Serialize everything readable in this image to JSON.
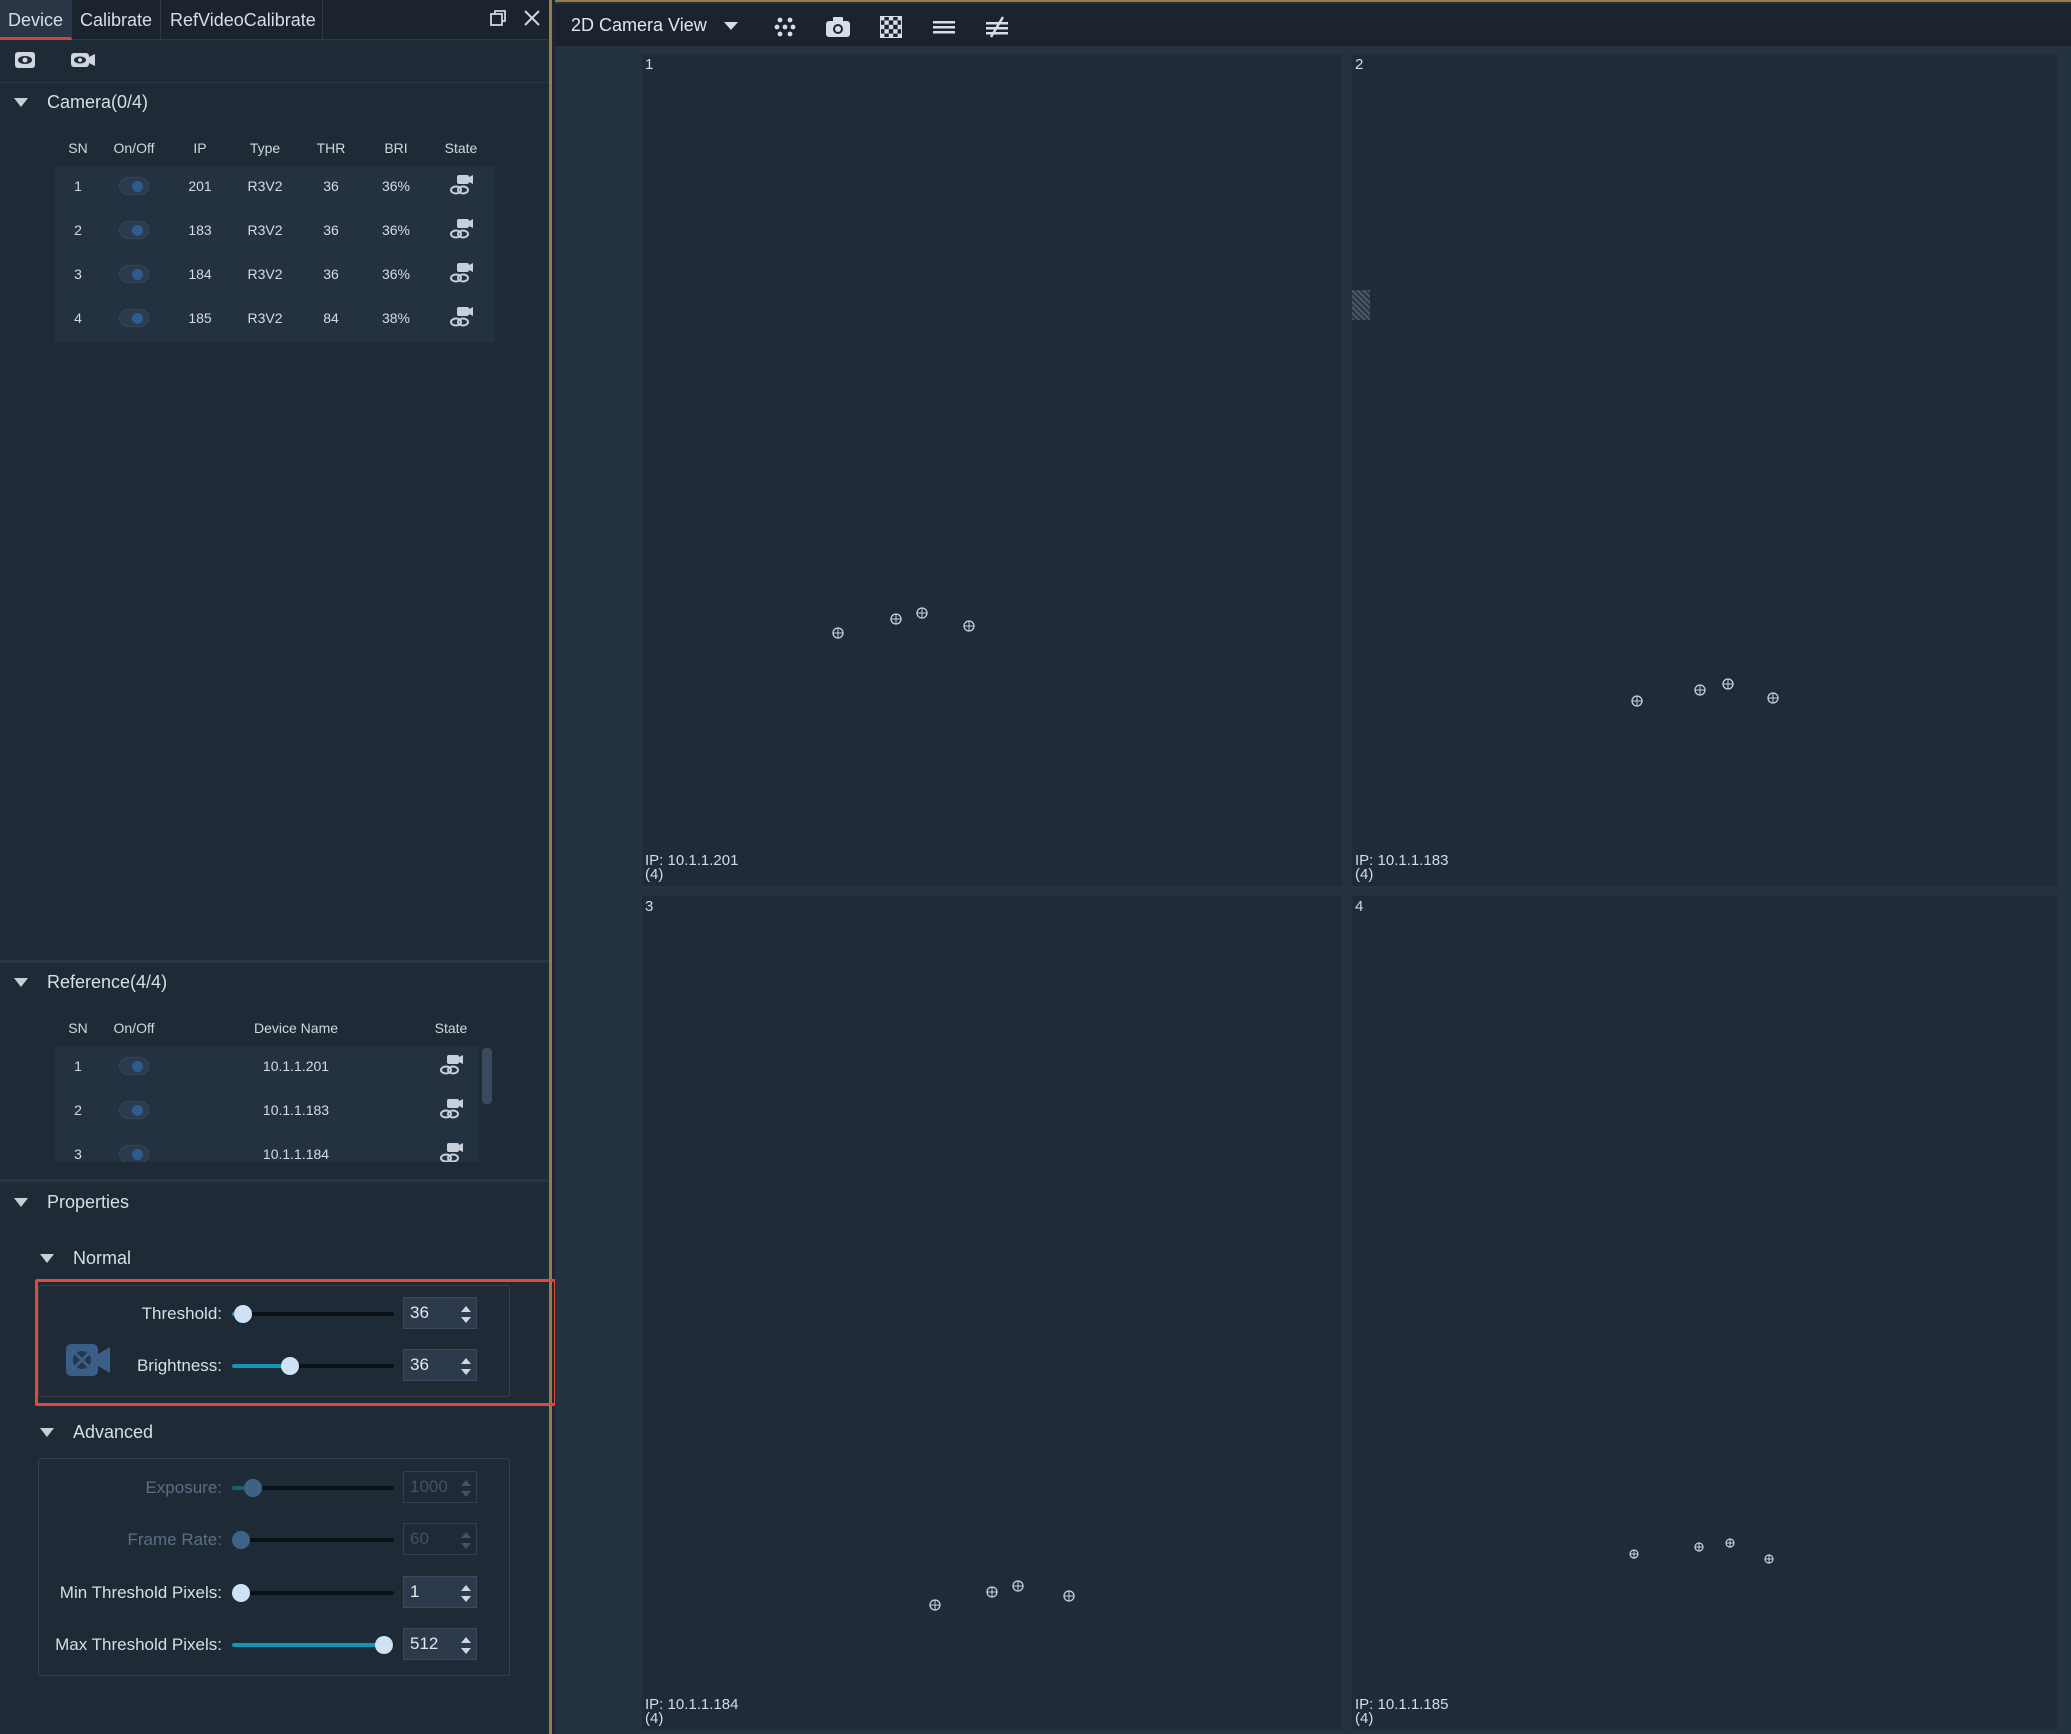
{
  "tabs": [
    {
      "label": "Device",
      "active": true
    },
    {
      "label": "Calibrate",
      "active": false
    },
    {
      "label": "RefVideoCalibrate",
      "active": false
    }
  ],
  "camera_section": {
    "title": "Camera(0/4)",
    "headers": [
      "SN",
      "On/Off",
      "IP",
      "Type",
      "THR",
      "BRI",
      "State"
    ],
    "rows": [
      {
        "sn": "1",
        "ip": "201",
        "type": "R3V2",
        "thr": "36",
        "bri": "36%"
      },
      {
        "sn": "2",
        "ip": "183",
        "type": "R3V2",
        "thr": "36",
        "bri": "36%"
      },
      {
        "sn": "3",
        "ip": "184",
        "type": "R3V2",
        "thr": "36",
        "bri": "36%"
      },
      {
        "sn": "4",
        "ip": "185",
        "type": "R3V2",
        "thr": "84",
        "bri": "38%"
      }
    ]
  },
  "reference_section": {
    "title": "Reference(4/4)",
    "headers": [
      "SN",
      "On/Off",
      "Device Name",
      "State"
    ],
    "rows": [
      {
        "sn": "1",
        "name": "10.1.1.201"
      },
      {
        "sn": "2",
        "name": "10.1.1.183"
      },
      {
        "sn": "3",
        "name": "10.1.1.184"
      }
    ]
  },
  "properties": {
    "title": "Properties",
    "normal": {
      "title": "Normal",
      "threshold": {
        "label": "Threshold:",
        "value": "36",
        "fraction": 0.07
      },
      "brightness": {
        "label": "Brightness:",
        "value": "36",
        "fraction": 0.36
      }
    },
    "advanced": {
      "title": "Advanced",
      "exposure": {
        "label": "Exposure:",
        "value": "1000",
        "fraction": 0.13,
        "disabled": true
      },
      "frame_rate": {
        "label": "Frame Rate:",
        "value": "60",
        "fraction": 0.05,
        "disabled": true
      },
      "min_threshold": {
        "label": "Min Threshold Pixels:",
        "value": "1",
        "fraction": 0.0
      },
      "max_threshold": {
        "label": "Max Threshold Pixels:",
        "value": "512",
        "fraction": 0.94
      }
    }
  },
  "view_toolbar": {
    "mode": "2D Camera View",
    "icons": [
      "dots-grid-icon",
      "camera-icon",
      "checkerboard-icon",
      "lines-icon",
      "not-equal-icon"
    ]
  },
  "views": [
    {
      "num": "1",
      "ip": "IP: 10.1.1.201",
      "count": "(4)"
    },
    {
      "num": "2",
      "ip": "IP: 10.1.1.183",
      "count": "(4)"
    },
    {
      "num": "3",
      "ip": "IP: 10.1.1.184",
      "count": "(4)"
    },
    {
      "num": "4",
      "ip": "IP: 10.1.1.185",
      "count": "(4)"
    }
  ],
  "colors": {
    "accent": "#1596b5",
    "highlight": "#e04a3e",
    "active_tab": "#d6433a"
  }
}
